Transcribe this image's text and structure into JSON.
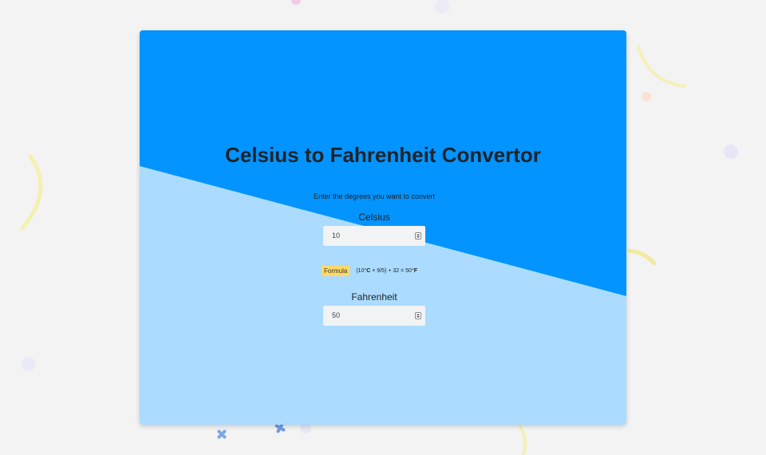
{
  "page": {
    "title": "Celsius to Fahrenheit Convertor",
    "instruction": "Enter the degrees you want to convert"
  },
  "celsius": {
    "label": "Celsius",
    "value": "10"
  },
  "formula": {
    "badge": "Formula",
    "expression_start": "(10°",
    "c_unit": "C",
    "expression_mid": " × 9/5) + 32 = 50°",
    "f_unit": "F"
  },
  "fahrenheit": {
    "label": "Fahrenheit",
    "value": "50"
  },
  "colors": {
    "page_background": "#f3f3f3",
    "card_top": "#0394ff",
    "card_bottom": "#abdcff",
    "formula_badge": "#ffd966",
    "input_background": "#f1f3f4"
  },
  "icons": {
    "input_spinner": "up-down-spinner-icon",
    "decorations": [
      "arc-decoration-icon",
      "dot-decoration-icon",
      "star-decoration-icon"
    ]
  }
}
